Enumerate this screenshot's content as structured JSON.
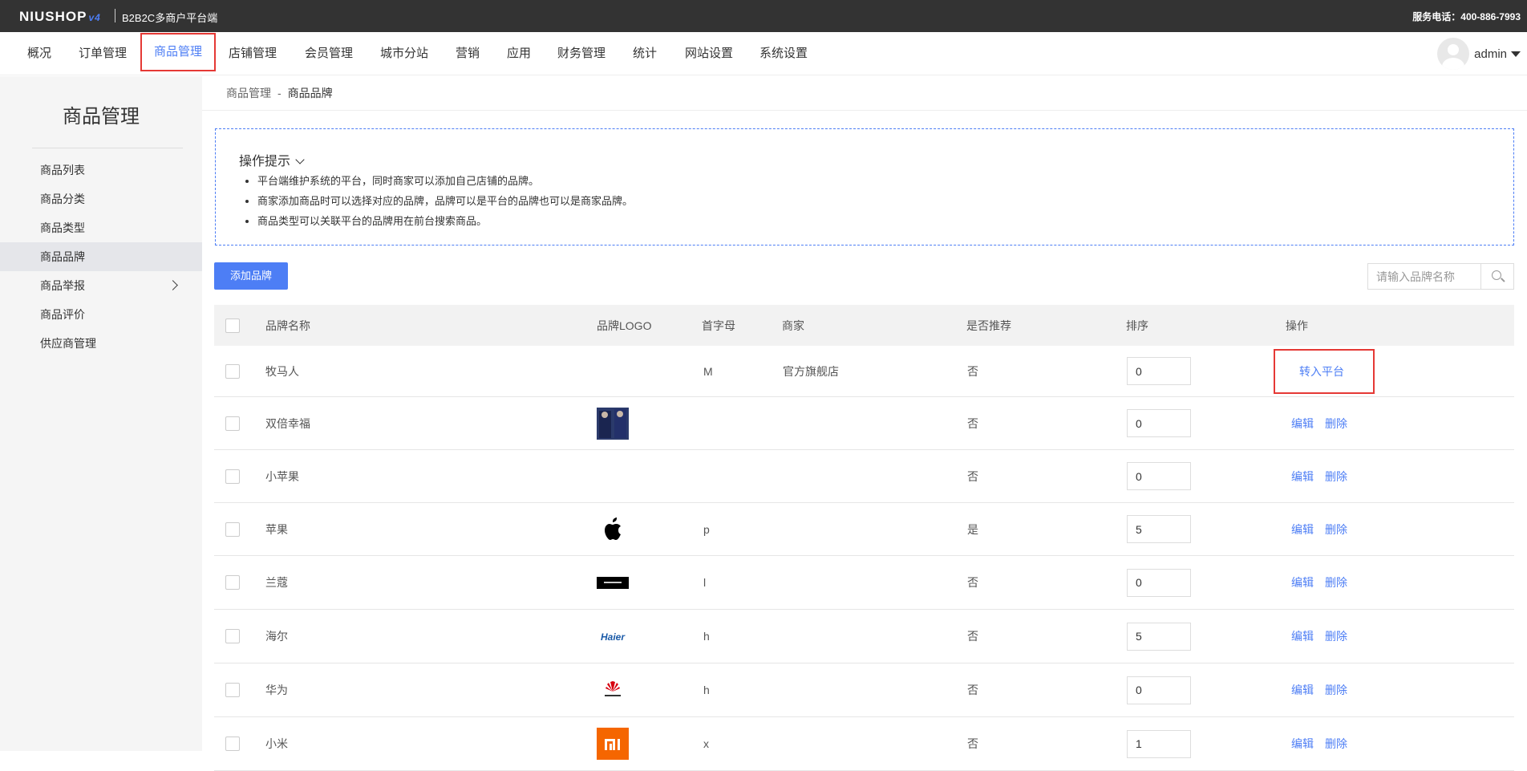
{
  "header": {
    "logo_text": "NIUSHOP",
    "logo_version": "v4",
    "subtitle": "B2B2C多商户平台端",
    "phone": "服务电话：400-886-7993"
  },
  "nav": {
    "items": [
      "概况",
      "订单管理",
      "商品管理",
      "店铺管理",
      "会员管理",
      "城市分站",
      "营销",
      "应用",
      "财务管理",
      "统计",
      "网站设置",
      "系统设置"
    ],
    "active": "商品管理",
    "user": "admin"
  },
  "sidebar": {
    "title": "商品管理",
    "items": [
      "商品列表",
      "商品分类",
      "商品类型",
      "商品品牌",
      "商品举报",
      "商品评价",
      "供应商管理"
    ],
    "active": "商品品牌"
  },
  "breadcrumb": {
    "parent": "商品管理",
    "separator": "-",
    "current": "商品品牌"
  },
  "tips": {
    "title": "操作提示",
    "lines": [
      "平台端维护系统的平台，同时商家可以添加自己店铺的品牌。",
      "商家添加商品时可以选择对应的品牌，品牌可以是平台的品牌也可以是商家品牌。",
      "商品类型可以关联平台的品牌用在前台搜索商品。"
    ]
  },
  "toolbar": {
    "add_label": "添加品牌",
    "search_placeholder": "请输入品牌名称"
  },
  "table": {
    "headers": {
      "name": "品牌名称",
      "logo": "品牌LOGO",
      "letter": "首字母",
      "merchant": "商家",
      "recommend": "是否推荐",
      "sort": "排序",
      "action": "操作"
    },
    "actions": {
      "transfer": "转入平台",
      "edit": "编辑",
      "delete": "删除"
    },
    "rows": [
      {
        "name": "牧马人",
        "logo": "",
        "letter": "M",
        "merchant": "官方旗舰店",
        "recommend": "否",
        "sort": "0",
        "action_type": "transfer"
      },
      {
        "name": "双倍幸福",
        "logo": "photo",
        "letter": "",
        "merchant": "",
        "recommend": "否",
        "sort": "0",
        "action_type": "edit"
      },
      {
        "name": "小苹果",
        "logo": "",
        "letter": "",
        "merchant": "",
        "recommend": "否",
        "sort": "0",
        "action_type": "edit"
      },
      {
        "name": "苹果",
        "logo": "apple",
        "letter": "p",
        "merchant": "",
        "recommend": "是",
        "sort": "5",
        "action_type": "edit"
      },
      {
        "name": "兰蔻",
        "logo": "lancome",
        "letter": "l",
        "merchant": "",
        "recommend": "否",
        "sort": "0",
        "action_type": "edit"
      },
      {
        "name": "海尔",
        "logo": "haier",
        "letter": "h",
        "merchant": "",
        "recommend": "否",
        "sort": "5",
        "action_type": "edit"
      },
      {
        "name": "华为",
        "logo": "huawei",
        "letter": "h",
        "merchant": "",
        "recommend": "否",
        "sort": "0",
        "action_type": "edit"
      },
      {
        "name": "小米",
        "logo": "mi",
        "letter": "x",
        "merchant": "",
        "recommend": "否",
        "sort": "1",
        "action_type": "edit"
      }
    ]
  },
  "colors": {
    "accent": "#4d7ef5",
    "highlight": "#e53935",
    "topbar": "#333333"
  }
}
